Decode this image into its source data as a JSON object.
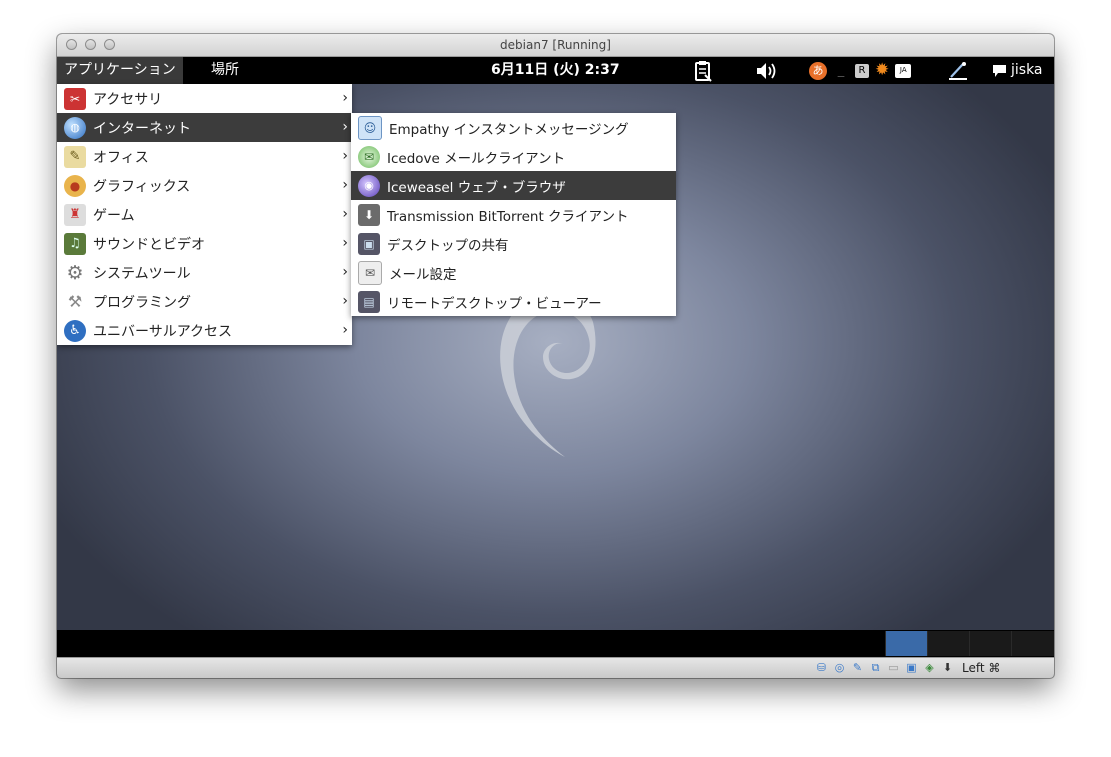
{
  "window": {
    "title": "debian7 [Running]"
  },
  "topbar": {
    "applications_label": "アプリケーション",
    "places_label": "場所",
    "clock": "6月11日 (火) 2:37",
    "username": "jiska"
  },
  "menu": {
    "items": [
      {
        "label": "アクセサリ",
        "icon": "accessories-icon"
      },
      {
        "label": "インターネット",
        "icon": "internet-globe-icon"
      },
      {
        "label": "オフィス",
        "icon": "office-icon"
      },
      {
        "label": "グラフィックス",
        "icon": "graphics-palette-icon"
      },
      {
        "label": "ゲーム",
        "icon": "games-joystick-icon"
      },
      {
        "label": "サウンドとビデオ",
        "icon": "sound-video-icon"
      },
      {
        "label": "システムツール",
        "icon": "system-tools-gear-icon"
      },
      {
        "label": "プログラミング",
        "icon": "programming-icon"
      },
      {
        "label": "ユニバーサルアクセス",
        "icon": "universal-access-icon"
      }
    ],
    "arrow": "›"
  },
  "submenu": {
    "items": [
      {
        "label": "Empathy インスタントメッセージング",
        "icon": "empathy-icon"
      },
      {
        "label": "Icedove メールクライアント",
        "icon": "icedove-icon"
      },
      {
        "label": "Iceweasel ウェブ・ブラウザ",
        "icon": "iceweasel-icon"
      },
      {
        "label": "Transmission BitTorrent クライアント",
        "icon": "transmission-icon"
      },
      {
        "label": "デスクトップの共有",
        "icon": "desktop-sharing-icon"
      },
      {
        "label": "メール設定",
        "icon": "mail-settings-icon"
      },
      {
        "label": "リモートデスクトップ・ビューアー",
        "icon": "remote-desktop-icon"
      }
    ]
  },
  "statusbar": {
    "host_key": "Left ⌘"
  },
  "colors": {
    "menu_highlight": "#3c3c3c",
    "workspace_active": "#3a6aa8"
  }
}
